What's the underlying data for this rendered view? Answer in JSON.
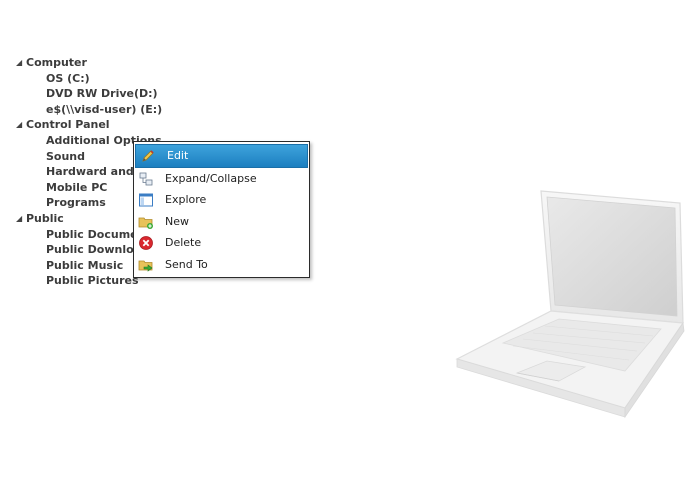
{
  "tree": {
    "groups": [
      {
        "label": "Computer",
        "children": [
          "OS (C:)",
          "DVD RW Drive(D:)",
          "e$(\\\\visd-user) (E:)"
        ]
      },
      {
        "label": "Control Panel",
        "children": [
          "Additional Options",
          "Sound",
          "Hardward and Sound",
          "Mobile PC",
          "Programs"
        ]
      },
      {
        "label": "Public",
        "children": [
          "Public Documents",
          "Public Downloads",
          "Public Music",
          "Public Pictures"
        ]
      }
    ],
    "expand_glyph": "◢"
  },
  "context_menu": {
    "items": [
      {
        "label": "Edit",
        "icon": "pencil-icon",
        "selected": true
      },
      {
        "label": "Expand/Collapse",
        "icon": "expand-collapse-icon",
        "selected": false
      },
      {
        "label": "Explore",
        "icon": "explore-icon",
        "selected": false
      },
      {
        "label": "New",
        "icon": "new-folder-icon",
        "selected": false
      },
      {
        "label": "Delete",
        "icon": "delete-icon",
        "selected": false
      },
      {
        "label": "Send To",
        "icon": "send-to-icon",
        "selected": false
      }
    ]
  },
  "colors": {
    "accent": "#1c7fc0",
    "delete": "#d9272e",
    "folder": "#e8c25a"
  }
}
